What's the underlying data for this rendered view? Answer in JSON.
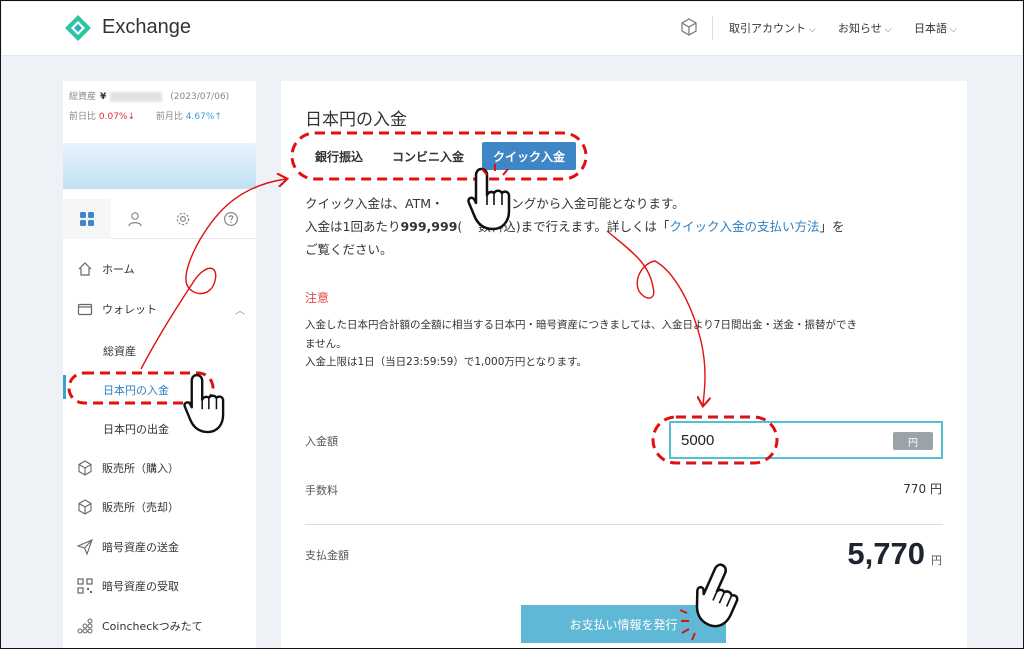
{
  "header": {
    "brand": "Exchange",
    "nav": [
      {
        "label": "取引アカウント"
      },
      {
        "label": "お知らせ"
      },
      {
        "label": "日本語"
      }
    ]
  },
  "sidebar": {
    "total_assets_label": "総資産",
    "currency_symbol": "¥",
    "date": "(2023/07/06)",
    "day_change_label": "前日比",
    "day_change": "0.07%↓",
    "month_change_label": "前月比",
    "month_change": "4.67%↑",
    "menu": {
      "home": "ホーム",
      "wallet": "ウォレット",
      "wallet_sub": [
        "総資産",
        "日本円の入金",
        "日本円の出金"
      ],
      "buy": "販売所（購入）",
      "sell": "販売所（売却）",
      "send": "暗号資産の送金",
      "receive": "暗号資産の受取",
      "tsumitate": "Coincheckつみたて"
    }
  },
  "main": {
    "title": "日本円の入金",
    "tabs": [
      "銀行振込",
      "コンビニ入金",
      "クイック入金"
    ],
    "active_tab": "クイック入金",
    "desc_line1": "クイック入金は、ATM・",
    "desc_line1_tail": "バンキングから入金可能となります。",
    "desc_line2_a": "入金は1回あたり",
    "desc_line2_bold": "999,999",
    "desc_line2_b": "(",
    "desc_line2_c": "数料込)まで行えます。詳しくは「",
    "desc_line2_link": "クイック入金の支払い方法",
    "desc_line2_d": "」を",
    "desc_line3": "ご覧ください。",
    "notice_title": "注意",
    "notice_line1": "入金した日本円合計額の全額に相当する日本円・暗号資産につきましては、入金日より7日間出金・送金・振替ができ",
    "notice_line2": "ません。",
    "notice_line3": "入金上限は1日（当日23:59:59）で1,000万円となります。",
    "amount_label": "入金額",
    "amount_value": "5000",
    "amount_unit": "円",
    "fee_label": "手数料",
    "fee_value": "770 円",
    "total_label": "支払金額",
    "total_value": "5,770",
    "total_unit": "円",
    "pay_button": "お支払い情報を発行"
  },
  "colors": {
    "accent_blue": "#3f86c6",
    "input_border": "#52c2d2",
    "annotation_red": "#e01010",
    "button": "#5fb9d6"
  }
}
